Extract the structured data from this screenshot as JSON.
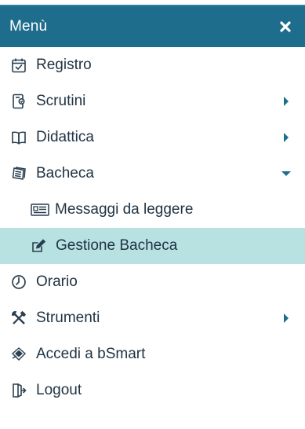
{
  "menu": {
    "title": "Menù",
    "close_icon": "close-icon",
    "accent_color": "#1f6d8c",
    "active_color": "#b8e1e2",
    "items": [
      {
        "id": "registro",
        "label": "Registro",
        "icon": "calendar-check-icon",
        "caret": null
      },
      {
        "id": "scrutini",
        "label": "Scrutini",
        "icon": "scrutini-icon",
        "caret": "right"
      },
      {
        "id": "didattica",
        "label": "Didattica",
        "icon": "book-open-icon",
        "caret": "right"
      },
      {
        "id": "bacheca",
        "label": "Bacheca",
        "icon": "newspaper-icon",
        "caret": "down"
      },
      {
        "id": "messaggi",
        "label": "Messaggi da leggere",
        "icon": "news-card-icon",
        "caret": null,
        "sub": true
      },
      {
        "id": "gestione",
        "label": "Gestione Bacheca",
        "icon": "edit-icon",
        "caret": null,
        "sub": true,
        "active": true
      },
      {
        "id": "orario",
        "label": "Orario",
        "icon": "clock-icon",
        "caret": null
      },
      {
        "id": "strumenti",
        "label": "Strumenti",
        "icon": "tools-icon",
        "caret": "right"
      },
      {
        "id": "bsmart",
        "label": "Accedi a bSmart",
        "icon": "bsmart-icon",
        "caret": null
      },
      {
        "id": "logout",
        "label": "Logout",
        "icon": "logout-icon",
        "caret": null
      }
    ]
  }
}
